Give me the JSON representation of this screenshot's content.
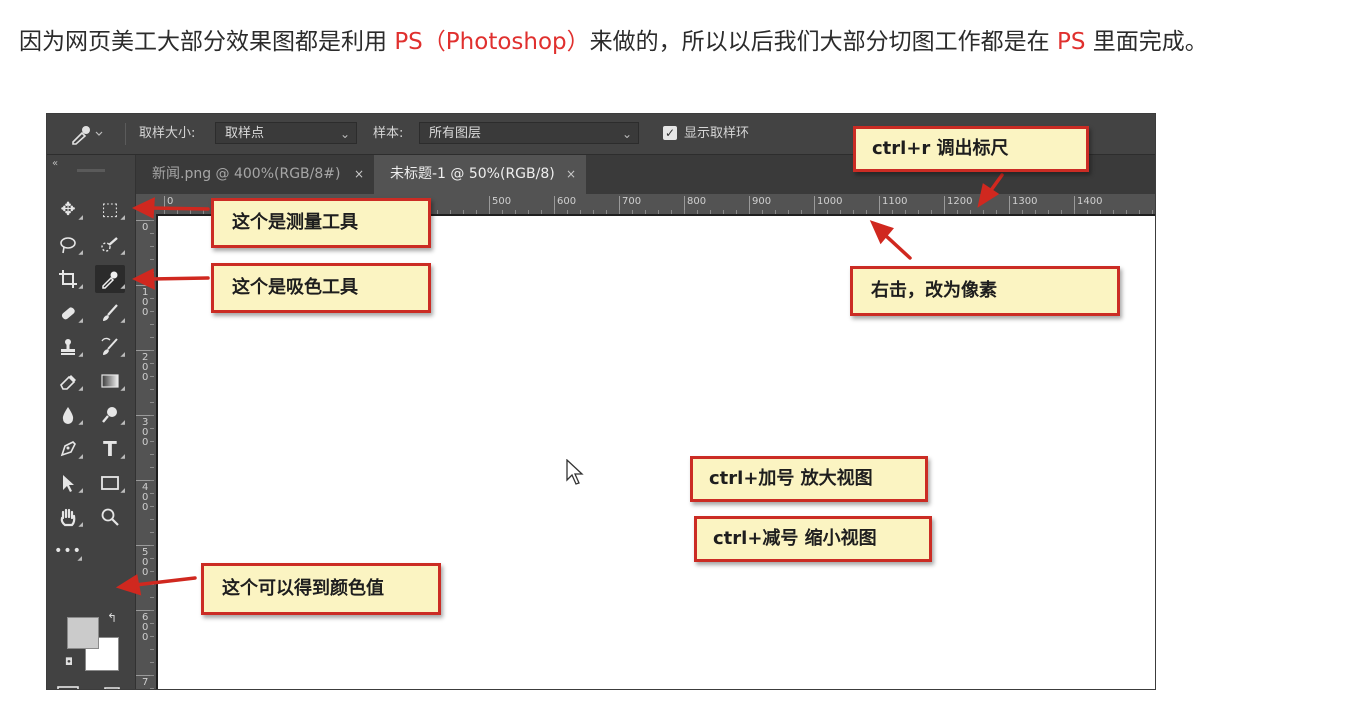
{
  "intro": {
    "part1": "因为网页美工大部分效果图都是利用 ",
    "ps": "PS",
    "part2": "（",
    "photoshop": "Photoshop",
    "part3": "）",
    "part4": "来做的，所以以后我们大部分切图工作都是在 ",
    "ps2": "PS",
    "part5": " 里面完成。"
  },
  "options_bar": {
    "sample_size_label": "取样大小:",
    "sample_size_value": "取样点",
    "sample_label": "样本:",
    "sample_value": "所有图层",
    "show_ring_label": "显示取样环",
    "show_ring_checked": true,
    "collapse_glyph": "«"
  },
  "tabs": [
    {
      "label": "新闻.png @ 400%(RGB/8#)",
      "active": false,
      "close": "×"
    },
    {
      "label": "未标题-1 @ 50%(RGB/8)",
      "active": true,
      "close": "×"
    }
  ],
  "ruler_top": [
    "0",
    "500",
    "600",
    "700",
    "800",
    "900",
    "1000",
    "1100",
    "1200",
    "1300",
    "1400"
  ],
  "ruler_left": [
    "0",
    "100",
    "200",
    "300",
    "400",
    "500",
    "600",
    "7"
  ],
  "tools": [
    {
      "icon": "move-icon",
      "glyph": "✥"
    },
    {
      "icon": "marquee-icon",
      "glyph": "⬚"
    },
    {
      "icon": "lasso-icon",
      "glyph": "ᑭ"
    },
    {
      "icon": "quick-select-icon",
      "glyph": "✐"
    },
    {
      "icon": "crop-icon",
      "glyph": "⌗"
    },
    {
      "icon": "eyedropper-icon",
      "glyph": "✎"
    },
    {
      "icon": "healing-brush-icon",
      "glyph": "✚"
    },
    {
      "icon": "brush-icon",
      "glyph": "✏"
    },
    {
      "icon": "stamp-icon",
      "glyph": "⊥"
    },
    {
      "icon": "history-brush-icon",
      "glyph": "✍"
    },
    {
      "icon": "eraser-icon",
      "glyph": "⌫"
    },
    {
      "icon": "gradient-icon",
      "glyph": "■"
    },
    {
      "icon": "blur-icon",
      "glyph": "●"
    },
    {
      "icon": "dodge-icon",
      "glyph": "⚲"
    },
    {
      "icon": "pen-icon",
      "glyph": "✒"
    },
    {
      "icon": "type-icon",
      "glyph": "T"
    },
    {
      "icon": "path-select-icon",
      "glyph": "➤"
    },
    {
      "icon": "rectangle-icon",
      "glyph": "▭"
    },
    {
      "icon": "hand-icon",
      "glyph": "✋"
    },
    {
      "icon": "zoom-icon",
      "glyph": "⚲"
    },
    {
      "icon": "more-tools-icon",
      "glyph": "•••"
    }
  ],
  "callouts": {
    "measure": "这个是测量工具",
    "eyedropper": "这个是吸色工具",
    "ruler": "ctrl+r 调出标尺",
    "right_click": "右击，改为像素",
    "zoom_in": "ctrl+加号 放大视图",
    "zoom_out": "ctrl+减号 缩小视图",
    "color_value": "这个可以得到颜色值"
  },
  "colors": {
    "accent_red": "#e0302e",
    "callout_bg": "#fbf4c2",
    "callout_border": "#cb2c24",
    "ps_panel": "#535353",
    "ps_toolbar": "#424242",
    "foreground_swatch": "#cbcbcb",
    "background_swatch": "#ffffff"
  }
}
